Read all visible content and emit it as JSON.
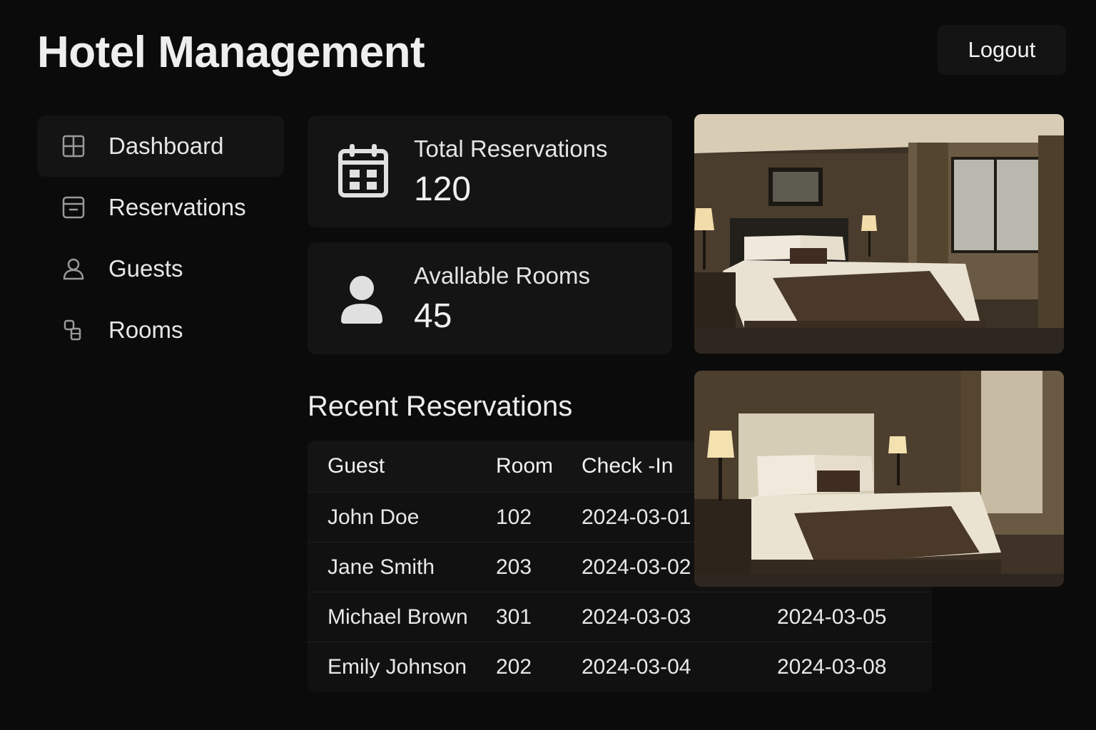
{
  "header": {
    "title": "Hotel Management",
    "logout_label": "Logout"
  },
  "sidebar": {
    "items": [
      {
        "label": "Dashboard",
        "icon": "grid-icon",
        "active": true
      },
      {
        "label": "Reservations",
        "icon": "inbox-icon",
        "active": false
      },
      {
        "label": "Guests",
        "icon": "user-icon",
        "active": false
      },
      {
        "label": "Rooms",
        "icon": "rooms-icon",
        "active": false
      }
    ]
  },
  "stats": [
    {
      "label": "Total Reservations",
      "value": "120",
      "icon": "calendar-icon"
    },
    {
      "label": "Avallable Rooms",
      "value": "45",
      "icon": "person-icon"
    }
  ],
  "recent": {
    "title": "Recent Reservations",
    "columns": [
      "Guest",
      "Room",
      "Check -In",
      ""
    ],
    "rows": [
      [
        "John Doe",
        "102",
        "2024-03-01",
        ""
      ],
      [
        "Jane Smith",
        "203",
        "2024-03-02",
        ""
      ],
      [
        "Michael Brown",
        "301",
        "2024-03-03",
        "2024-03-05"
      ],
      [
        "Emily Johnson",
        "202",
        "2024-03-04",
        "2024-03-08"
      ]
    ]
  },
  "photos": [
    {
      "subject": "hotel-room-photo"
    },
    {
      "subject": "hotel-room-photo"
    }
  ],
  "colors": {
    "background": "#0b0b0b",
    "card": "#141414",
    "text": "#ededed"
  }
}
